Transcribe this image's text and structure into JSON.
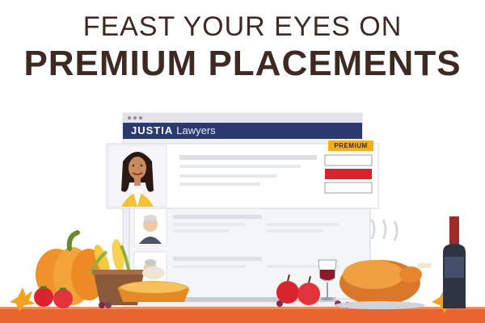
{
  "headline": {
    "line1": "FEAST YOUR EYES ON",
    "line2": "PREMIUM PLACEMENTS"
  },
  "browser": {
    "brand": "JUSTIA",
    "brand_suffix": "Lawyers",
    "premium_badge": "PREMIUM"
  },
  "colors": {
    "headline": "#3e2a22",
    "brand_bar": "#2b3a6e",
    "premium_badge": "#f2b01e",
    "cta_red": "#d9232e",
    "table": "#e8642c"
  },
  "icons": [
    "pumpkin",
    "corn",
    "pie",
    "apples",
    "wine-glass",
    "wine-bottle",
    "roast-turkey",
    "tomatoes",
    "maple-leaves",
    "grapes"
  ]
}
